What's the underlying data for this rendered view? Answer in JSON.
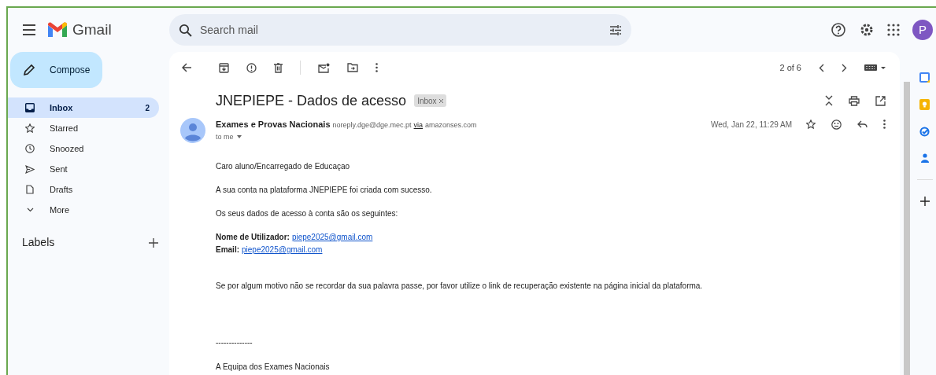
{
  "app": {
    "name": "Gmail",
    "search_placeholder": "Search mail",
    "avatar_letter": "P"
  },
  "sidebar": {
    "compose": "Compose",
    "items": [
      {
        "label": "Inbox",
        "count": "2",
        "selected": true
      },
      {
        "label": "Starred",
        "selected": false
      },
      {
        "label": "Snoozed",
        "selected": false
      },
      {
        "label": "Sent",
        "selected": false
      },
      {
        "label": "Drafts",
        "selected": false
      },
      {
        "label": "More",
        "selected": false
      }
    ],
    "labels_heading": "Labels"
  },
  "toolbar": {
    "pagination": "2 of 6"
  },
  "email": {
    "subject": "JNEPIEPE - Dados de acesso",
    "label_chip": "Inbox",
    "sender_name": "Exames e Provas Nacionais",
    "sender_address": "noreply.dge@dge.mec.pt",
    "via": "via",
    "via_domain": "amazonses.com",
    "recipient": "to me",
    "date": "Wed, Jan 22, 11:29 AM",
    "body": [
      [
        {
          "kind": "text",
          "text": "Caro aluno/Encarregado de Educaçao"
        }
      ],
      [
        {
          "kind": "text",
          "text": "A sua conta na plataforma JNEPIEPE foi criada com sucesso."
        }
      ],
      [
        {
          "kind": "text",
          "text": "Os seus dados de acesso à conta são os seguintes:"
        }
      ],
      [
        {
          "kind": "field",
          "label": "Nome de Utilizador:",
          "link": "piepe2025@gmail.com"
        },
        {
          "kind": "field",
          "label": "Email:",
          "link": "piepe2025@gmail.com"
        }
      ],
      [
        {
          "kind": "text",
          "text": "Se por algum motivo não se recordar da sua palavra passe, por favor utilize o link de recuperação existente na página inicial da plataforma."
        }
      ],
      [
        {
          "kind": "text",
          "text": "--------------"
        }
      ],
      [
        {
          "kind": "text",
          "text": "A Equipa dos Exames Nacionais"
        }
      ]
    ]
  }
}
